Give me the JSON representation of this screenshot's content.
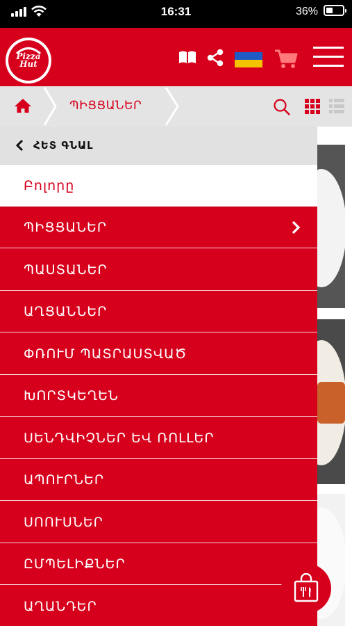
{
  "status_bar": {
    "time": "16:31",
    "battery": "36%"
  },
  "header": {
    "logo_line1": "Pizza",
    "logo_line2": "Hut",
    "icons": [
      "menu-book-icon",
      "share-icon",
      "ukraine-flag-icon",
      "cart-icon",
      "hamburger-icon"
    ],
    "brand_color": "#d6001c"
  },
  "breadcrumb": {
    "home_icon": "home-icon",
    "current": "ՊԻՑՑԱՆԵՐ",
    "view_icons": [
      "search-icon",
      "grid-view-icon",
      "list-view-icon"
    ]
  },
  "menu": {
    "back_label": "ՀԵՏ ԳՆԱԼ",
    "items": [
      {
        "label": "Բոլորը",
        "active": true
      },
      {
        "label": "ՊԻՑՑԱՆԵՐ",
        "has_submenu": true
      },
      {
        "label": "ՊԱՍՏԱՆԵՐ"
      },
      {
        "label": "ԱՂՑԱՆՆԵՐ"
      },
      {
        "label": "ՓՌՈՒՄ ՊԱՏՐԱՍՏՎԱԾ"
      },
      {
        "label": "ԽՈՐՏԿԵՂԵՆ"
      },
      {
        "label": "ՍԵՆԴՎԻՉՆԵՐ ԵՎ ՌՈԼԼԵՐ"
      },
      {
        "label": "ԱՊՈՒՐՆԵՐ"
      },
      {
        "label": "ՍՈՈՒՍՆԵՐ"
      },
      {
        "label": "ԸՄՊԵԼԻՔՆԵՐ"
      },
      {
        "label": "ԱՂԱՆԴԵՐ"
      }
    ]
  },
  "fab_icon": "shopping-bag-icon"
}
